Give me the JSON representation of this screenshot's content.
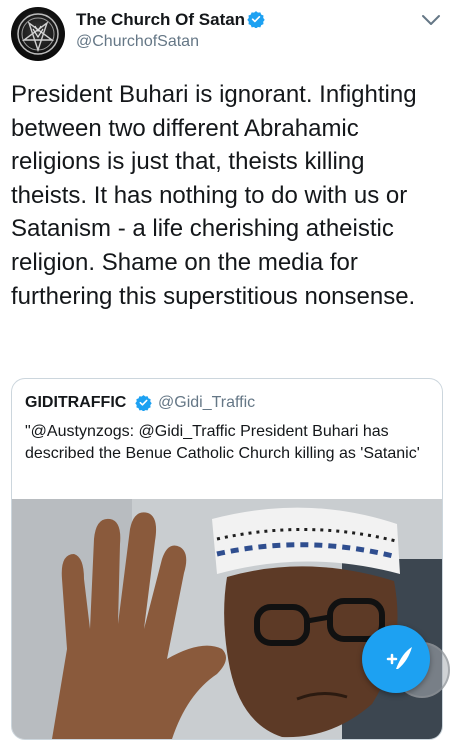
{
  "tweet": {
    "author_name": "The Church Of Satan",
    "author_handle": "@ChurchofSatan",
    "text": "President Buhari is ignorant. Infighting between two different Abrahamic religions is just that, theists killing theists. It has nothing to do with us or Satanism - a life cherishing atheistic religion. Shame on the media for furthering this superstitious nonsense."
  },
  "quoted_tweet": {
    "author_name": "GIDITRAFFIC",
    "author_handle": "@Gidi_Traffic",
    "text": "\"@Austynzogs: @Gidi_Traffic President Buhari has described the Benue Catholic Church killing as 'Satanic'"
  },
  "colors": {
    "accent": "#1da1f2",
    "text": "#14171a",
    "secondary_text": "#657786",
    "border": "#ccd6dd"
  },
  "icons": {
    "verified": "verified-badge-icon",
    "menu": "chevron-down-icon",
    "compose": "compose-tweet-icon"
  }
}
